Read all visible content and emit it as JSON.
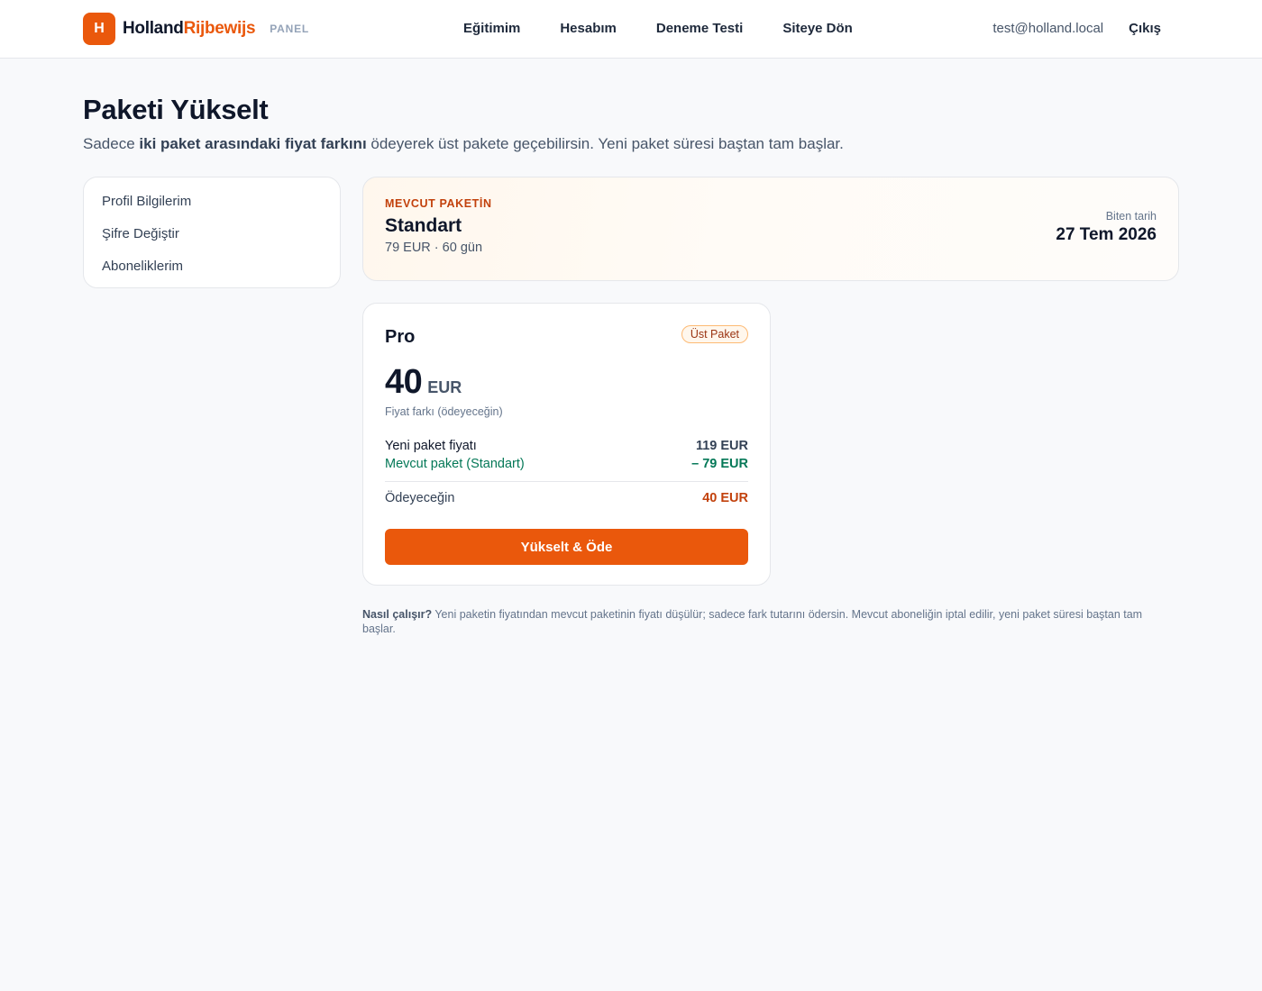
{
  "brand": {
    "logo_letter": "H",
    "name_part1": "Holland",
    "name_part2": "Rijbewijs",
    "tag": "PANEL"
  },
  "nav": {
    "items": [
      {
        "label": "Eğitimim"
      },
      {
        "label": "Hesabım"
      },
      {
        "label": "Deneme Testi"
      },
      {
        "label": "Siteye Dön"
      }
    ]
  },
  "user": {
    "email": "test@holland.local",
    "logout_label": "Çıkış"
  },
  "page": {
    "title": "Paketi Yükselt",
    "subtitle_pre": "Sadece ",
    "subtitle_bold": "iki paket arasındaki fiyat farkını",
    "subtitle_post": " ödeyerek üst pakete geçebilirsin. Yeni paket süresi baştan tam başlar."
  },
  "sidebar": {
    "items": [
      {
        "label": "Profil Bilgilerim"
      },
      {
        "label": "Şifre Değiştir"
      },
      {
        "label": "Aboneliklerim"
      }
    ]
  },
  "current_package": {
    "label": "MEVCUT PAKETİN",
    "name": "Standart",
    "meta": "79 EUR · 60 gün",
    "end_label": "Biten tarih",
    "end_date": "27 Tem 2026"
  },
  "upgrade": {
    "plan_name": "Pro",
    "badge": "Üst Paket",
    "price": "40",
    "currency": "EUR",
    "price_note": "Fiyat farkı (ödeyeceğin)",
    "lines": [
      {
        "label": "Yeni paket fiyatı",
        "value": "119 EUR"
      },
      {
        "label": "Mevcut paket (Standart)",
        "value": "– 79 EUR"
      }
    ],
    "total_label": "Ödeyeceğin",
    "total_value": "40 EUR",
    "cta_label": "Yükselt & Öde"
  },
  "info": {
    "bold": "Nasıl çalışır?",
    "text": " Yeni paketin fiyatından mevcut paketinin fiyatı düşülür; sadece fark tutarını ödersin. Mevcut aboneliğin iptal edilir, yeni paket süresi baştan tam başlar."
  },
  "colors": {
    "accent": "#ea580c",
    "accent_dark": "#c2410c",
    "discount_green": "#047857"
  }
}
